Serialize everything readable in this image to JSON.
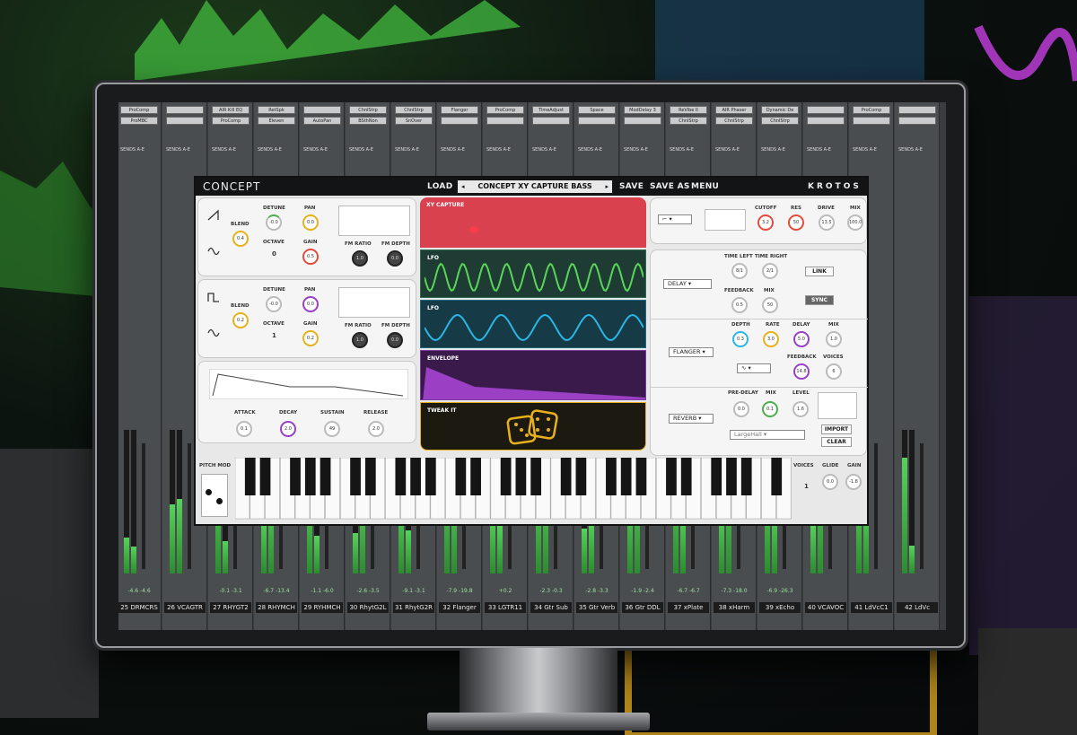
{
  "daw": {
    "strips": [
      {
        "name": "25 DRMCRS",
        "vol": "-4.6  -4.6",
        "ins1": "ProComp",
        "ins2": "ProMBC"
      },
      {
        "name": "26 VCAGTR",
        "vol": "",
        "ins1": "",
        "ins2": ""
      },
      {
        "name": "27 RHYGT2",
        "vol": "-0.1  -3.1",
        "ins1": "AIR Kill EQ",
        "ins2": "ProComp"
      },
      {
        "name": "28 RHYMCH",
        "vol": "-6.7  -13.4",
        "ins1": "RetSpk",
        "ins2": "Eleven"
      },
      {
        "name": "29 RYHMCH",
        "vol": "-1.1  -6.0",
        "ins1": "",
        "ins2": "AutoPan"
      },
      {
        "name": "30 RhytG2L",
        "vol": "-2.6  -3.5",
        "ins1": "ChnlStrp",
        "ins2": "BSthNon"
      },
      {
        "name": "31 RhytG2R",
        "vol": "-9.1  -3.1",
        "ins1": "ChnlStrp",
        "ins2": "SnOver"
      },
      {
        "name": "32 Flanger",
        "vol": "-7.9  -19.8",
        "ins1": "Flanger",
        "ins2": ""
      },
      {
        "name": "33 LGTR11",
        "vol": "+0.2",
        "ins1": "ProComp",
        "ins2": ""
      },
      {
        "name": "34 Gtr Sub",
        "vol": "-2.3  -0.3",
        "ins1": "TimeAdjust",
        "ins2": ""
      },
      {
        "name": "35 Gtr Verb",
        "vol": "-2.8  -3.3",
        "ins1": "Space",
        "ins2": ""
      },
      {
        "name": "36 Gtr DDL",
        "vol": "-1.9  -2.4",
        "ins1": "ModDelay 3",
        "ins2": ""
      },
      {
        "name": "37 xPlate",
        "vol": "-6.7  -6.7",
        "ins1": "ReVibe II",
        "ins2": "ChnlStrp"
      },
      {
        "name": "38 xHarm",
        "vol": "-7.3  -18.0",
        "ins1": "AIR Phaser",
        "ins2": "ChnlStrp"
      },
      {
        "name": "39 xEcho",
        "vol": "-6.9  -26.3",
        "ins1": "Dynamic De",
        "ins2": "ChnlStrp"
      },
      {
        "name": "40 VCAVOC",
        "vol": "",
        "ins1": "",
        "ins2": ""
      },
      {
        "name": "41 LdVcC1",
        "vol": "",
        "ins1": "ProComp",
        "ins2": ""
      },
      {
        "name": "42 LdVc",
        "vol": "",
        "ins1": "",
        "ins2": ""
      }
    ],
    "sends_label": "SENDS A-E"
  },
  "plugin": {
    "logo": "CONCEPT",
    "brand": "KROTOS",
    "load": "LOAD",
    "save": "SAVE",
    "save_as": "SAVE AS",
    "menu": "MENU",
    "preset": "CONCEPT XY CAPTURE BASS",
    "prev_icon": "◂",
    "next_icon": "▸",
    "osc1": {
      "blend": "BLEND",
      "blend_val": "0.4",
      "detune": "DETUNE",
      "detune_val": "-0.0",
      "octave": "OCTAVE",
      "octave_val": "0",
      "pan": "PAN",
      "pan_val": "0.0",
      "gain": "GAIN",
      "gain_val": "0.5",
      "fm_ratio": "FM RATIO",
      "fm_ratio_val": "1.0",
      "fm_depth": "FM DEPTH",
      "fm_depth_val": "0.0"
    },
    "osc2": {
      "blend": "BLEND",
      "blend_val": "0.2",
      "detune": "DETUNE",
      "detune_val": "-0.0",
      "octave": "OCTAVE",
      "octave_val": "1",
      "pan": "PAN",
      "pan_val": "0.0",
      "gain": "GAIN",
      "gain_val": "0.2",
      "fm_ratio": "FM RATIO",
      "fm_ratio_val": "1.0",
      "fm_depth": "FM DEPTH",
      "fm_depth_val": "0.0"
    },
    "env": {
      "attack": "ATTACK",
      "attack_val": "0.1",
      "decay": "DECAY",
      "decay_val": "2.0",
      "sustain": "SUSTAIN",
      "sustain_val": "49",
      "release": "RELEASE",
      "release_val": "2.0"
    },
    "filter": {
      "cutoff": "CUTOFF",
      "cutoff_val": "3.2",
      "res": "RES",
      "res_val": "50",
      "drive": "DRIVE",
      "drive_val": "13.5",
      "mix": "MIX",
      "mix_val": "100.0"
    },
    "mods": {
      "xy": "XY CAPTURE",
      "lfo1": "LFO",
      "lfo2": "LFO",
      "envelope": "ENVELOPE",
      "tweak": "TWEAK IT"
    },
    "delay": {
      "type": "DELAY",
      "time_left": "TIME LEFT",
      "time_left_val": "8/1",
      "time_right": "TIME RIGHT",
      "time_right_val": "2/1",
      "feedback": "FEEDBACK",
      "feedback_val": "0.5",
      "mix": "MIX",
      "mix_val": "50",
      "link": "LINK",
      "sync": "SYNC"
    },
    "flanger": {
      "type": "FLANGER",
      "depth": "DEPTH",
      "depth_val": "0.3",
      "rate": "RATE",
      "rate_val": "3.0",
      "delay": "DELAY",
      "delay_val": "5.0",
      "mix": "MIX",
      "mix_val": "1.0",
      "feedback": "FEEDBACK",
      "feedback_val": "14.8",
      "voices": "VOICES",
      "voices_val": "6"
    },
    "reverb": {
      "type": "REVERB",
      "predelay": "PRE-DELAY",
      "predelay_val": "0.0",
      "mix": "MIX",
      "mix_val": "0.1",
      "level": "LEVEL",
      "level_val": "1.6",
      "preset": "LargeHall",
      "import": "IMPORT",
      "clear": "CLEAR"
    },
    "keys": {
      "pitch_mod": "PITCH MOD",
      "voices": "VOICES",
      "voices_val": "1",
      "glide": "GLIDE",
      "glide_val": "0.0",
      "gain": "GAIN",
      "gain_val": "-1.8"
    },
    "colors": {
      "xy": "#d9414f",
      "lfo1": "#1f3c34",
      "lfo1_wave": "#58d658",
      "lfo2": "#163b46",
      "lfo2_wave": "#2ab6e6",
      "envelope": "#3a1a4a",
      "env_fill": "#9b3fc4",
      "tweak": "#1c1910",
      "dice": "#e8b01c"
    }
  }
}
